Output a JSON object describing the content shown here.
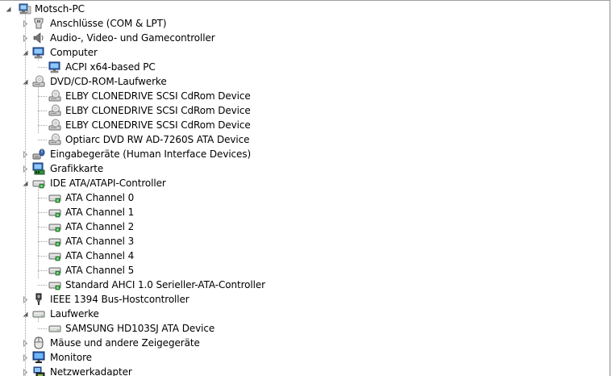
{
  "root": {
    "label": "Motsch-PC",
    "icon": "computer-icon"
  },
  "tree": [
    {
      "label": "Anschlüsse (COM & LPT)",
      "icon": "port-icon",
      "expanded": false,
      "children": []
    },
    {
      "label": "Audio-, Video- und Gamecontroller",
      "icon": "speaker-icon",
      "expanded": false,
      "children": []
    },
    {
      "label": "Computer",
      "icon": "computer-monitor-icon",
      "expanded": true,
      "children": [
        {
          "label": "ACPI x64-based PC",
          "icon": "computer-monitor-icon"
        }
      ]
    },
    {
      "label": "DVD/CD-ROM-Laufwerke",
      "icon": "optical-drive-icon",
      "expanded": true,
      "children": [
        {
          "label": "ELBY CLONEDRIVE SCSI CdRom Device",
          "icon": "optical-drive-icon"
        },
        {
          "label": "ELBY CLONEDRIVE SCSI CdRom Device",
          "icon": "optical-drive-icon"
        },
        {
          "label": "ELBY CLONEDRIVE SCSI CdRom Device",
          "icon": "optical-drive-icon"
        },
        {
          "label": "Optiarc DVD RW AD-7260S ATA Device",
          "icon": "optical-drive-icon"
        }
      ]
    },
    {
      "label": "Eingabegeräte (Human Interface Devices)",
      "icon": "hid-icon",
      "expanded": false,
      "children": []
    },
    {
      "label": "Grafikkarte",
      "icon": "display-adapter-icon",
      "expanded": false,
      "children": []
    },
    {
      "label": "IDE ATA/ATAPI-Controller",
      "icon": "ide-controller-icon",
      "expanded": true,
      "children": [
        {
          "label": "ATA Channel 0",
          "icon": "ide-controller-icon"
        },
        {
          "label": "ATA Channel 1",
          "icon": "ide-controller-icon"
        },
        {
          "label": "ATA Channel 2",
          "icon": "ide-controller-icon"
        },
        {
          "label": "ATA Channel 3",
          "icon": "ide-controller-icon"
        },
        {
          "label": "ATA Channel 4",
          "icon": "ide-controller-icon"
        },
        {
          "label": "ATA Channel 5",
          "icon": "ide-controller-icon"
        },
        {
          "label": "Standard AHCI 1.0 Serieller-ATA-Controller",
          "icon": "ide-controller-icon"
        }
      ]
    },
    {
      "label": "IEEE 1394 Bus-Hostcontroller",
      "icon": "firewire-icon",
      "expanded": false,
      "children": []
    },
    {
      "label": "Laufwerke",
      "icon": "disk-drive-icon",
      "expanded": true,
      "children": [
        {
          "label": "SAMSUNG HD103SJ ATA Device",
          "icon": "disk-drive-icon"
        }
      ]
    },
    {
      "label": "Mäuse und andere Zeigegeräte",
      "icon": "mouse-icon",
      "expanded": false,
      "children": []
    },
    {
      "label": "Monitore",
      "icon": "monitor-icon",
      "expanded": false,
      "children": []
    },
    {
      "label": "Netzwerkadapter",
      "icon": "network-adapter-icon",
      "expanded": false,
      "children": []
    }
  ],
  "colors": {
    "guide": "#a0a0a0",
    "expander": "#595959",
    "window_border": "#828790"
  }
}
